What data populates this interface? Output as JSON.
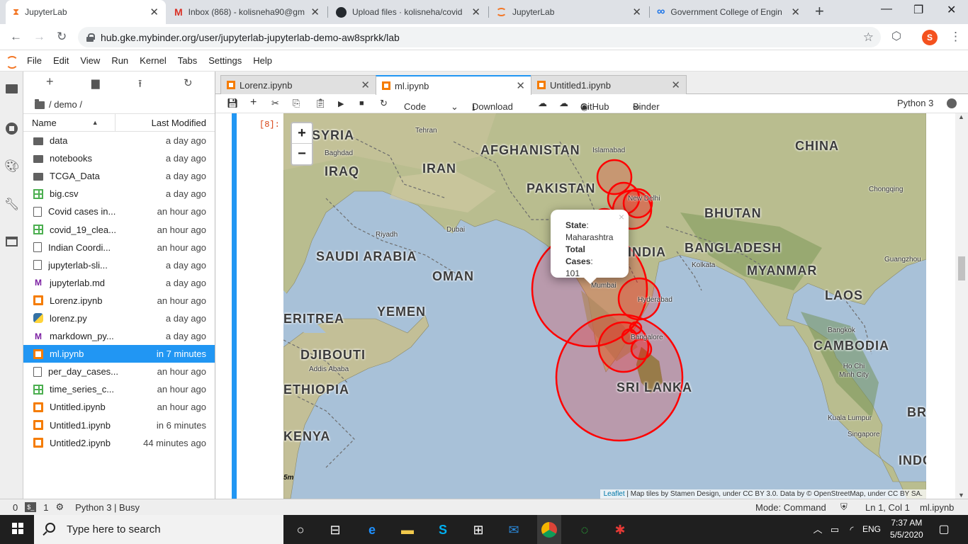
{
  "browser": {
    "tabs": [
      {
        "title": "JupyterLab"
      },
      {
        "title": "Inbox (868) - kolisneha90@gm"
      },
      {
        "title": "Upload files · kolisneha/covid"
      },
      {
        "title": "JupyterLab"
      },
      {
        "title": "Government College of Engin"
      }
    ],
    "url": "hub.gke.mybinder.org/user/jupyterlab-jupyterlab-demo-aw8sprkk/lab",
    "avatar_letter": "S"
  },
  "menu": [
    "File",
    "Edit",
    "View",
    "Run",
    "Kernel",
    "Tabs",
    "Settings",
    "Help"
  ],
  "filebrowser": {
    "breadcrumb": "/ demo /",
    "col_name": "Name",
    "col_modified": "Last Modified",
    "files": [
      {
        "name": "data",
        "modified": "a day ago",
        "type": "folder"
      },
      {
        "name": "notebooks",
        "modified": "a day ago",
        "type": "folder"
      },
      {
        "name": "TCGA_Data",
        "modified": "a day ago",
        "type": "folder"
      },
      {
        "name": "big.csv",
        "modified": "a day ago",
        "type": "csv"
      },
      {
        "name": "Covid cases in...",
        "modified": "an hour ago",
        "type": "file"
      },
      {
        "name": "covid_19_clea...",
        "modified": "an hour ago",
        "type": "csv"
      },
      {
        "name": "Indian Coordi...",
        "modified": "an hour ago",
        "type": "file"
      },
      {
        "name": "jupyterlab-sli...",
        "modified": "a day ago",
        "type": "file"
      },
      {
        "name": "jupyterlab.md",
        "modified": "a day ago",
        "type": "md"
      },
      {
        "name": "Lorenz.ipynb",
        "modified": "an hour ago",
        "type": "nb"
      },
      {
        "name": "lorenz.py",
        "modified": "a day ago",
        "type": "py"
      },
      {
        "name": "markdown_py...",
        "modified": "a day ago",
        "type": "md"
      },
      {
        "name": "ml.ipynb",
        "modified": "in 7 minutes",
        "type": "nb"
      },
      {
        "name": "per_day_cases...",
        "modified": "an hour ago",
        "type": "file"
      },
      {
        "name": "time_series_c...",
        "modified": "an hour ago",
        "type": "csv"
      },
      {
        "name": "Untitled.ipynb",
        "modified": "an hour ago",
        "type": "nb"
      },
      {
        "name": "Untitled1.ipynb",
        "modified": "in 6 minutes",
        "type": "nb"
      },
      {
        "name": "Untitled2.ipynb",
        "modified": "44 minutes ago",
        "type": "nb"
      }
    ]
  },
  "doc_tabs": [
    "Lorenz.ipynb",
    "ml.ipynb",
    "Untitled1.ipynb"
  ],
  "notebook_toolbar": {
    "cell_type": "Code",
    "download": "Download",
    "github": "GitHub",
    "binder": "Binder",
    "kernel": "Python 3"
  },
  "cell": {
    "prompt": "[8]:"
  },
  "map": {
    "zoom_in": "+",
    "zoom_out": "−",
    "labels": [
      "AFGHANISTAN",
      "CHINA",
      "IRAN",
      "IRAQ",
      "PAKISTAN",
      "BHUTAN",
      "INDIA",
      "BANGLADESH",
      "MYANMAR",
      "LAOS",
      "SAUDI ARABIA",
      "OMAN",
      "YEMEN",
      "ERITREA",
      "DJIBOUTI",
      "ETHIOPIA",
      "SRI LANKA",
      "CAMBODIA",
      "KENYA",
      "INDO",
      "BR",
      "SYRIA"
    ],
    "cities": [
      "Tehran",
      "Baghdad",
      "Islamabad",
      "New Delhi",
      "Riyadh",
      "Dubai",
      "Kolkata",
      "Mumbai",
      "Hyderabad",
      "Bangalore",
      "Chongqing",
      "Guangzhou",
      "Bangkok",
      "Ho Chi Minh City",
      "Addis Ababa",
      "Kuala Lumpur",
      "Singapore"
    ],
    "popup": {
      "state_label": "State",
      "state_value": "Maharashtra",
      "cases_label": "Total Cases",
      "cases_value": "101",
      "close": "×"
    },
    "attribution": {
      "leaflet": "Leaflet",
      "text": " | Map tiles by Stamen Design, under CC BY 3.0. Data by © OpenStreetMap, under CC BY SA."
    },
    "scale_unit": "5m",
    "circle_color": "#ff0000"
  },
  "statusbar": {
    "left0": "0",
    "left1": "1",
    "kernel_status": "Python 3 | Busy",
    "mode": "Mode: Command",
    "position": "Ln 1, Col 1",
    "file": "ml.ipynb"
  },
  "taskbar": {
    "search_placeholder": "Type here to search",
    "lang": "ENG",
    "time": "7:37 AM",
    "date": "5/5/2020"
  },
  "colors": {
    "jupyter_orange": "#f37726",
    "accent_blue": "#2196f3"
  }
}
